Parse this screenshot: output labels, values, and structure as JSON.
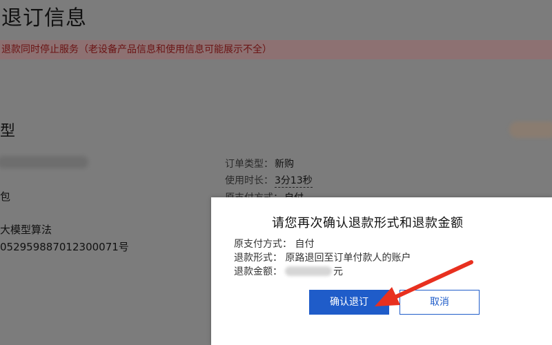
{
  "page": {
    "title": "退订信息",
    "notice": "退款同时停止服务（老设备产品信息和使用信息可能展示不全）",
    "section_title": "型",
    "left_lines": [
      "包",
      "大模型算法",
      "052959887012300071号"
    ]
  },
  "order_info": [
    {
      "label": "订单类型：",
      "value": "新购"
    },
    {
      "label": "使用时长：",
      "value": "3分13秒"
    },
    {
      "label": "原支付方式：",
      "value": "自付"
    }
  ],
  "dialog": {
    "title": "请您再次确认退款形式和退款金额",
    "payment_method": "原支付方式：  自付",
    "refund_method": "退款形式：  原路退回至订单付款人的账户",
    "refund_amount_label": "退款金额：",
    "refund_amount_unit": "元",
    "confirm_label": "确认退订",
    "cancel_label": "取消"
  },
  "colors": {
    "primary": "#1f5cc9",
    "overlay": "#7c7c7c",
    "notice_bg": "#8d7172",
    "arrow": "#e8301f"
  }
}
